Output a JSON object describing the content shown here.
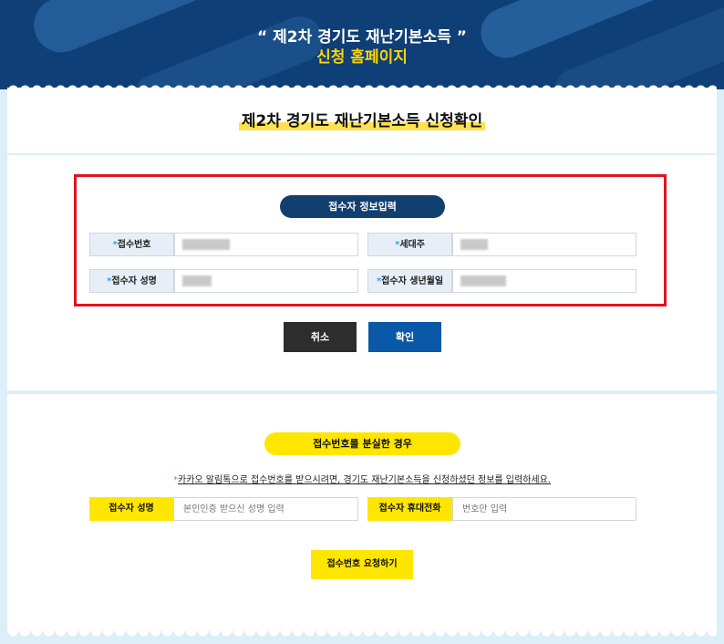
{
  "banner": {
    "title": "“ 제2차 경기도 재난기본소득 ”",
    "subtitle": "신청 홈페이지"
  },
  "page": {
    "title": "제2차 경기도 재난기본소득 신청확인"
  },
  "applicant_info": {
    "heading": "접수자 정보입력",
    "fields": [
      {
        "label": "접수번호",
        "required_mark": "*"
      },
      {
        "label": "세대주",
        "required_mark": "*"
      },
      {
        "label": "접수자 성명",
        "required_mark": "*"
      },
      {
        "label": "접수자 생년월일",
        "required_mark": "*"
      }
    ],
    "cancel_label": "취소",
    "confirm_label": "확인"
  },
  "lost_number": {
    "heading": "접수번호를 분실한 경우",
    "notice_mark": "*",
    "notice": "카카오 알림톡으로 접수번호를 받으시려면, 경기도 재난기본소득을 신청하셨던 정보를 입력하세요.",
    "name_label": "접수자 성명",
    "name_placeholder": "본인인증 받으신 성명 입력",
    "phone_label": "접수자 휴대전화",
    "phone_placeholder": "번호만 입력",
    "request_label": "접수번호 요청하기"
  },
  "colors": {
    "navy": "#0f3f77",
    "yellow": "#ffe600",
    "red_border": "#e0141e",
    "confirm_blue": "#0a58a8",
    "cancel_dark": "#2d2d2d"
  }
}
